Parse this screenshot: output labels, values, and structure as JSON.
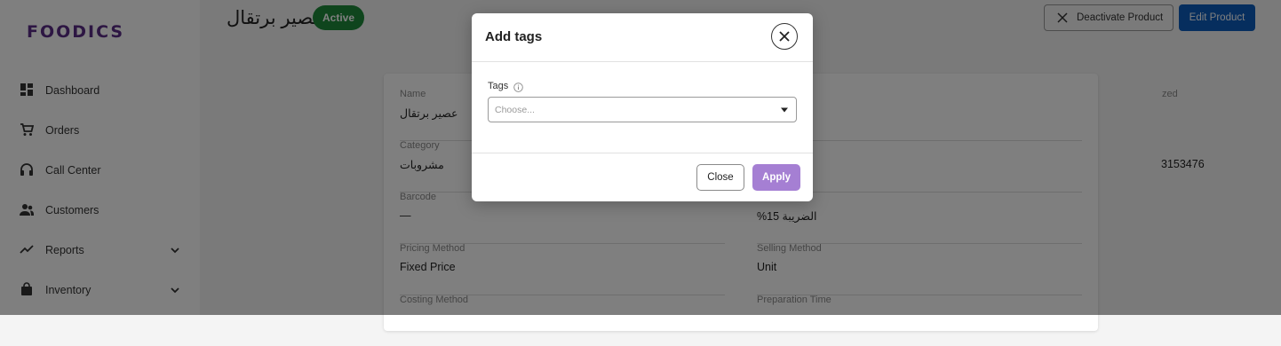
{
  "brand": {
    "logo_text": "FOODICS",
    "logo_color": "#5b2d86"
  },
  "sidebar": {
    "items": [
      {
        "label": "Dashboard",
        "icon": "dashboard-icon",
        "expandable": false
      },
      {
        "label": "Orders",
        "icon": "cart-icon",
        "expandable": false
      },
      {
        "label": "Call Center",
        "icon": "headset-icon",
        "expandable": false
      },
      {
        "label": "Customers",
        "icon": "people-icon",
        "expandable": false
      },
      {
        "label": "Reports",
        "icon": "trend-icon",
        "expandable": true
      },
      {
        "label": "Inventory",
        "icon": "bag-icon",
        "expandable": true
      }
    ]
  },
  "header": {
    "product_name": "عصير برتقال",
    "status": "Active",
    "status_color": "#1f8a3b",
    "deactivate_label": "Deactivate Product",
    "edit_label": "Edit Product",
    "edit_color": "#0d5dbd"
  },
  "details": {
    "left": [
      {
        "label": "Name",
        "value": "عصير برتقال"
      },
      {
        "label": "Category",
        "value": "مشروبات"
      },
      {
        "label": "Barcode",
        "value": "—"
      },
      {
        "label": "Pricing Method",
        "value": "Fixed Price"
      },
      {
        "label": "Costing Method",
        "value": ""
      }
    ],
    "right": [
      {
        "label": "zed",
        "value": ""
      },
      {
        "label": "",
        "value": "3153476"
      },
      {
        "label": "",
        "value": "الضريبة 15%"
      },
      {
        "label": "Selling Method",
        "value": "Unit"
      },
      {
        "label": "Preparation Time",
        "value": ""
      }
    ]
  },
  "modal": {
    "title": "Add tags",
    "tags_label": "Tags",
    "tags_placeholder": "Choose...",
    "close_label": "Close",
    "apply_label": "Apply",
    "apply_color": "#a57fd3"
  }
}
